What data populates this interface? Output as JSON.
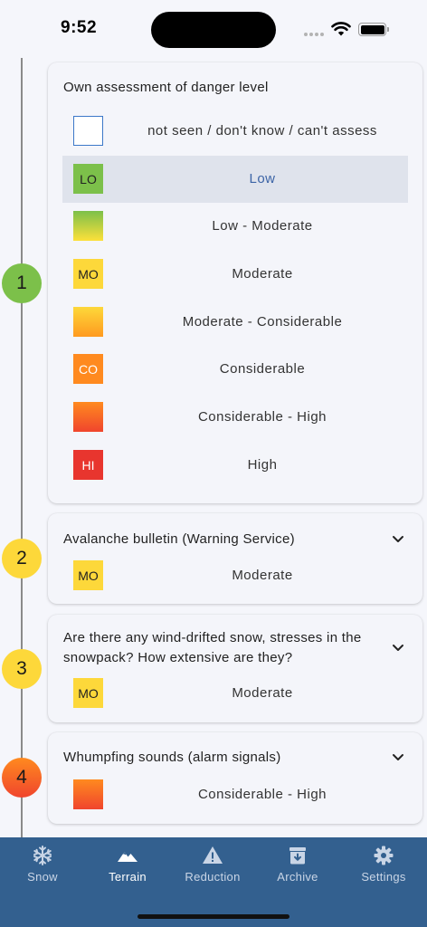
{
  "status_bar": {
    "time": "9:52"
  },
  "timeline": {
    "steps": [
      "1",
      "2",
      "3",
      "4"
    ]
  },
  "assessment": {
    "title": "Own assessment of danger level",
    "options": [
      {
        "code": "",
        "label": "not seen / don't know / can't assess"
      },
      {
        "code": "LO",
        "label": "Low",
        "selected": true
      },
      {
        "code": "",
        "label": "Low - Moderate"
      },
      {
        "code": "MO",
        "label": "Moderate"
      },
      {
        "code": "",
        "label": "Moderate - Considerable"
      },
      {
        "code": "CO",
        "label": "Considerable"
      },
      {
        "code": "",
        "label": "Considerable - High"
      },
      {
        "code": "HI",
        "label": "High"
      }
    ]
  },
  "questions": [
    {
      "question": "Avalanche bulletin (Warning Service)",
      "answer_code": "MO",
      "answer_label": "Moderate"
    },
    {
      "question": "Are there any wind-drifted snow, stresses in the snowpack? How extensive are they?",
      "answer_code": "MO",
      "answer_label": "Moderate"
    },
    {
      "question": "Whumpfing sounds (alarm signals)",
      "answer_code": "",
      "answer_label": "Considerable - High"
    }
  ],
  "bottom_nav": {
    "items": [
      {
        "label": "Snow",
        "icon": "snowflake-icon"
      },
      {
        "label": "Terrain",
        "icon": "mountain-icon",
        "active": true
      },
      {
        "label": "Reduction",
        "icon": "warning-icon"
      },
      {
        "label": "Archive",
        "icon": "archive-icon"
      },
      {
        "label": "Settings",
        "icon": "gear-icon"
      }
    ]
  },
  "colors": {
    "low": "#7cc04a",
    "moderate": "#fdd83a",
    "considerable": "#ff8a1f",
    "high": "#e8352e",
    "nav_background": "#33608f",
    "selected_text": "#3c64a6"
  }
}
